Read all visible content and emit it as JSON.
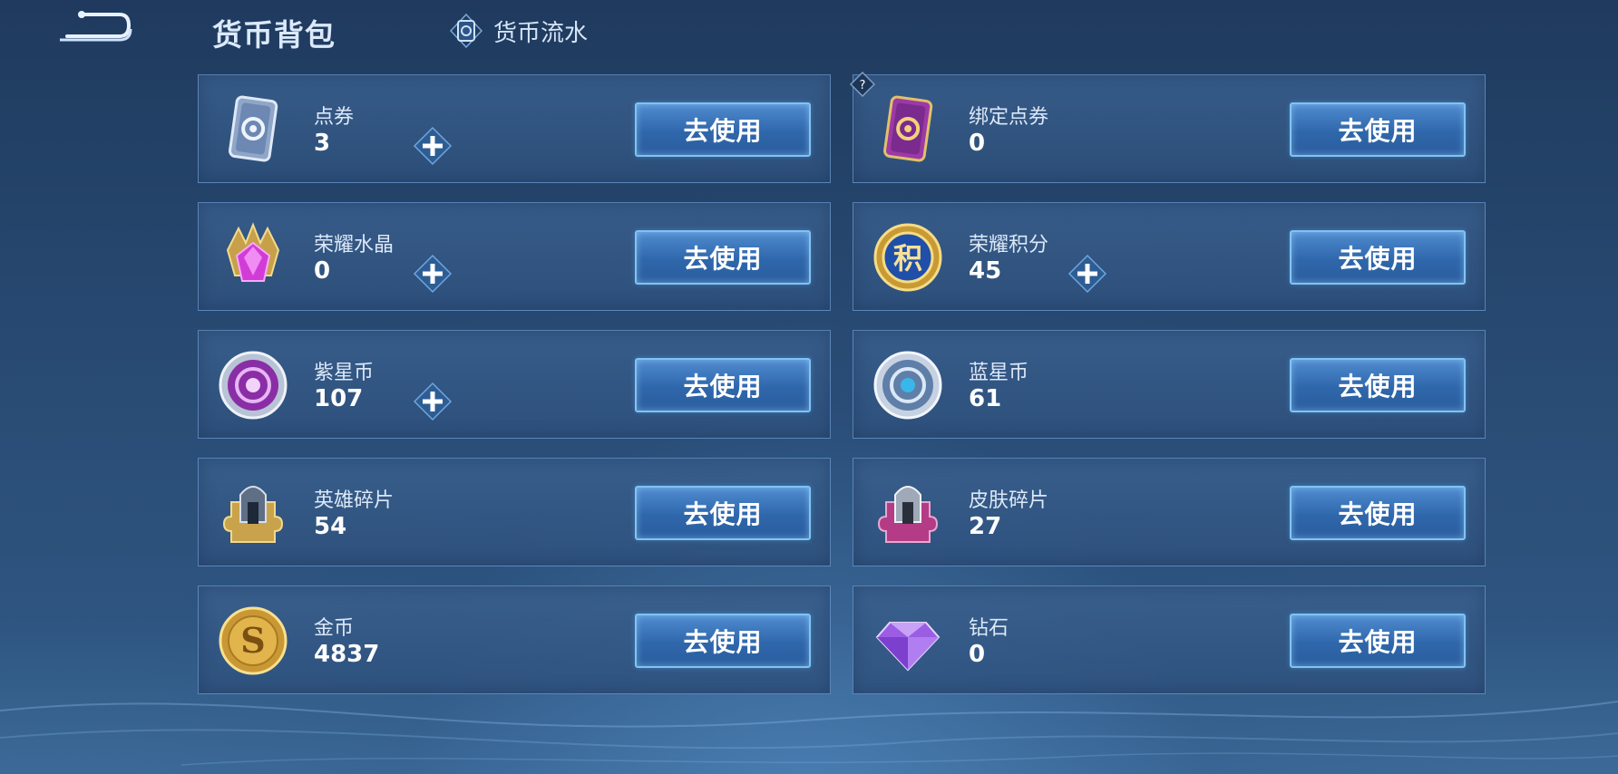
{
  "header": {
    "title": "货币背包",
    "flow_label": "货币流水"
  },
  "cards": [
    {
      "name": "点券",
      "amount": "3",
      "icon": "ticket-silver-icon",
      "has_plus": true,
      "button": "去使用"
    },
    {
      "name": "绑定点券",
      "amount": "0",
      "icon": "ticket-purple-icon",
      "has_plus": false,
      "has_help": true,
      "button": "去使用"
    },
    {
      "name": "荣耀水晶",
      "amount": "0",
      "icon": "glory-crystal-icon",
      "has_plus": true,
      "button": "去使用"
    },
    {
      "name": "荣耀积分",
      "amount": "45",
      "icon": "glory-points-icon",
      "icon_text": "积",
      "has_plus": true,
      "button": "去使用"
    },
    {
      "name": "紫星币",
      "amount": "107",
      "icon": "purple-star-coin-icon",
      "has_plus": true,
      "button": "去使用"
    },
    {
      "name": "蓝星币",
      "amount": "61",
      "icon": "blue-star-coin-icon",
      "has_plus": false,
      "button": "去使用"
    },
    {
      "name": "英雄碎片",
      "amount": "54",
      "icon": "hero-fragment-icon",
      "has_plus": false,
      "button": "去使用"
    },
    {
      "name": "皮肤碎片",
      "amount": "27",
      "icon": "skin-fragment-icon",
      "has_plus": false,
      "button": "去使用"
    },
    {
      "name": "金币",
      "amount": "4837",
      "icon": "gold-coin-icon",
      "icon_text": "S",
      "has_plus": false,
      "button": "去使用"
    },
    {
      "name": "钻石",
      "amount": "0",
      "icon": "diamond-icon",
      "has_plus": false,
      "button": "去使用"
    }
  ],
  "colors": {
    "accent": "#7ec4f4",
    "background": "#284a72"
  }
}
